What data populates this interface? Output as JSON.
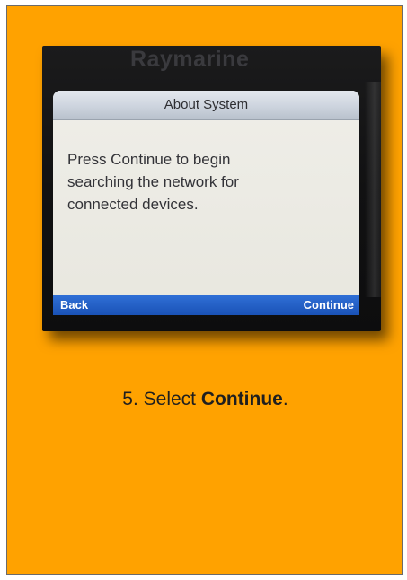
{
  "photo": {
    "brand": "Raymarine",
    "dialog": {
      "title": "About System",
      "body": "Press Continue to begin\nsearching the network for\nconnected devices.",
      "softkeys": {
        "left": "Back",
        "right": "Continue"
      }
    }
  },
  "caption": {
    "step": "5. Select ",
    "emphasis": "Continue",
    "suffix": "."
  },
  "colors": {
    "card_background": "#ffa200",
    "softkey_bar": "#1a52b6"
  }
}
